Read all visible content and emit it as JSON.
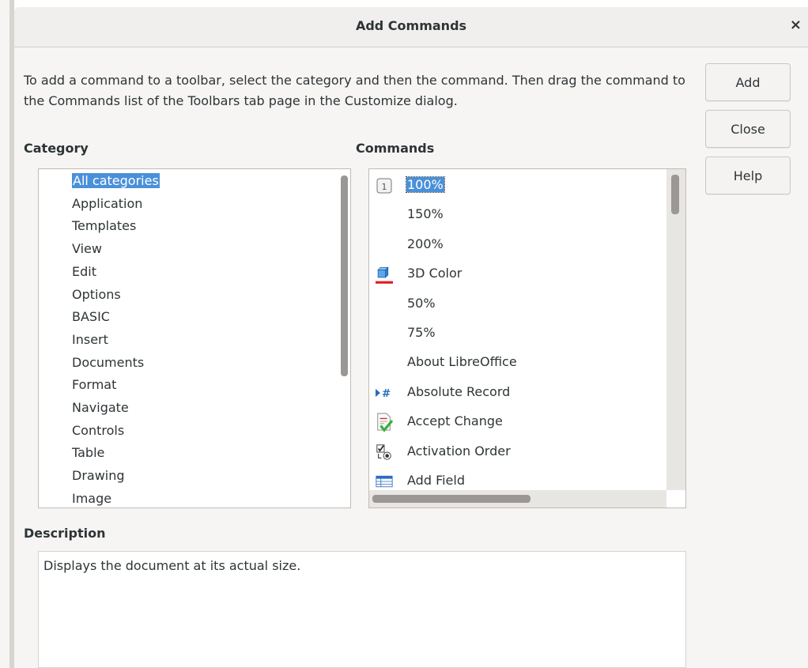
{
  "dialog": {
    "title": "Add Commands",
    "close_glyph": "×",
    "intro_text": "To add a command to a toolbar, select the category and then the command. Then drag the command to the Commands list of the Toolbars tab page in the Customize dialog."
  },
  "buttons": {
    "add": "Add",
    "close": "Close",
    "help": "Help"
  },
  "category": {
    "label": "Category",
    "selected_index": 0,
    "items": [
      "All categories",
      "Application",
      "Templates",
      "View",
      "Edit",
      "Options",
      "BASIC",
      "Insert",
      "Documents",
      "Format",
      "Navigate",
      "Controls",
      "Table",
      "Drawing",
      "Image"
    ]
  },
  "commands": {
    "label": "Commands",
    "selected_index": 0,
    "items": [
      {
        "label": "100%",
        "icon": "zoom-100-icon"
      },
      {
        "label": "150%",
        "icon": ""
      },
      {
        "label": "200%",
        "icon": ""
      },
      {
        "label": "3D Color",
        "icon": "3d-color-icon"
      },
      {
        "label": "50%",
        "icon": ""
      },
      {
        "label": "75%",
        "icon": ""
      },
      {
        "label": "About LibreOffice",
        "icon": ""
      },
      {
        "label": "Absolute Record",
        "icon": "absolute-record-icon"
      },
      {
        "label": "Accept Change",
        "icon": "accept-change-icon"
      },
      {
        "label": "Activation Order",
        "icon": "activation-order-icon"
      },
      {
        "label": "Add Field",
        "icon": "add-field-icon"
      }
    ]
  },
  "description": {
    "label": "Description",
    "text": "Displays the document at its actual size."
  },
  "colors": {
    "selection": "#4a90d9",
    "accent_underline": "#e01b24"
  }
}
